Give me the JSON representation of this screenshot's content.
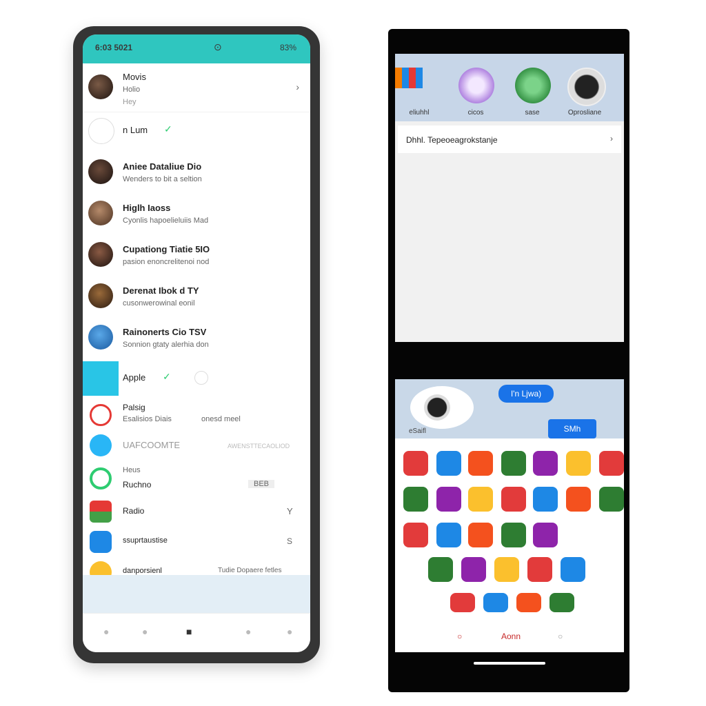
{
  "left_phone": {
    "status": {
      "time": "6:03 5021",
      "right": "83%",
      "mid": "⊙"
    },
    "header_contact": {
      "name": "Movis",
      "line1": "Holio",
      "line2": "Hey",
      "arrow": "›"
    },
    "online_row": {
      "name": "n Lum",
      "badge": "✓"
    },
    "chats": [
      {
        "name": "Aniee Dataliue Dio",
        "msg": "Wenders to bit a seltion"
      },
      {
        "name": "Higlh Iaoss",
        "msg": "Cyonlis hapoelieluiis Mad"
      },
      {
        "name": "Cupationg Tiatie 5IO",
        "msg": "pasion enoncrelitenoi nod"
      },
      {
        "name": "Derenat Ibok d TY",
        "msg": "cusonwerowinal eonil"
      },
      {
        "name": "Rainonerts Cio TSV",
        "msg": "Sonnion gtaty alerhia don"
      }
    ],
    "apps_row": {
      "name": "Apple",
      "badge": "✓"
    },
    "misc": [
      {
        "name": "Palsig",
        "sub": "Esalisios Diais",
        "extra": "onesd meel"
      },
      {
        "name": "UAFCOOMTE",
        "sub": "",
        "extra": "AWENSTTECAOLIOD"
      },
      {
        "name": "Heus",
        "sub": "Ruchno",
        "extra": "BEB"
      },
      {
        "name": "Radio",
        "sub": "",
        "extra": "Y"
      },
      {
        "name": "ssuprtaustise",
        "sub": "",
        "extra": "S"
      },
      {
        "name": "danporsienl",
        "sub": "",
        "extra": "Tudie Dopaere fetles"
      }
    ]
  },
  "right_phone": {
    "stories": [
      {
        "label": "eliuhhl"
      },
      {
        "label": "cicos"
      },
      {
        "label": "sase"
      },
      {
        "label": "Oprosliane"
      }
    ],
    "search": {
      "text": "Dhhl. Tepeoeagrokstanje",
      "arrow": "›"
    },
    "bottom_head": {
      "pill1": "I'n Ljwa)",
      "pill2": "SMh",
      "caption": "eSaifl"
    },
    "bottom_nav": {
      "left": "○",
      "mid": "Aonn",
      "right": "○"
    },
    "grid_colors": [
      "#e23b3b",
      "#1e88e5",
      "#f4511e",
      "#2e7d32",
      "#8e24aa",
      "#fbc02d"
    ]
  }
}
